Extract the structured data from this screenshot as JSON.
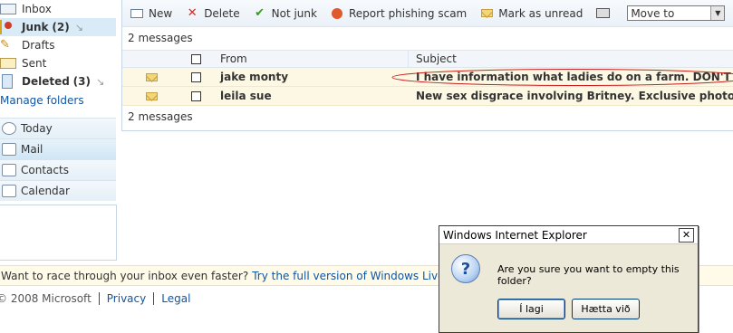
{
  "folders": [
    {
      "label": "Inbox",
      "count": "",
      "bold": false
    },
    {
      "label": "Junk",
      "count": "(2)",
      "bold": true
    },
    {
      "label": "Drafts",
      "count": "",
      "bold": false
    },
    {
      "label": "Sent",
      "count": "",
      "bold": false
    },
    {
      "label": "Deleted",
      "count": "(3)",
      "bold": true
    }
  ],
  "manage_folders": "Manage folders",
  "nav": [
    "Today",
    "Mail",
    "Contacts",
    "Calendar"
  ],
  "toolbar": {
    "new": "New",
    "delete": "Delete",
    "not_junk": "Not junk",
    "report_phishing": "Report phishing scam",
    "mark_unread": "Mark as unread",
    "move_to": "Move to"
  },
  "message_count": "2 messages",
  "columns": {
    "from": "From",
    "subject": "Subject"
  },
  "messages": [
    {
      "from": "jake monty",
      "subject": "I have information what ladies do on a farm. DON'T le"
    },
    {
      "from": "leila sue",
      "subject": "New sex disgrace involving Britney. Exclusive photos."
    }
  ],
  "promo": {
    "text": "Want to race through your inbox even faster?",
    "link": "Try the full version of Windows Live Ho"
  },
  "footer": {
    "copyright": "© 2008 Microsoft",
    "privacy": "Privacy",
    "legal": "Legal"
  },
  "dialog": {
    "title": "Windows Internet Explorer",
    "message": "Are you sure you want to empty this folder?",
    "ok": "Í lagi",
    "cancel": "Hætta við"
  },
  "colors": {
    "accent": "#0f55a5",
    "selected": "#d9ebf7",
    "junk_row": "#fdf8e3"
  }
}
